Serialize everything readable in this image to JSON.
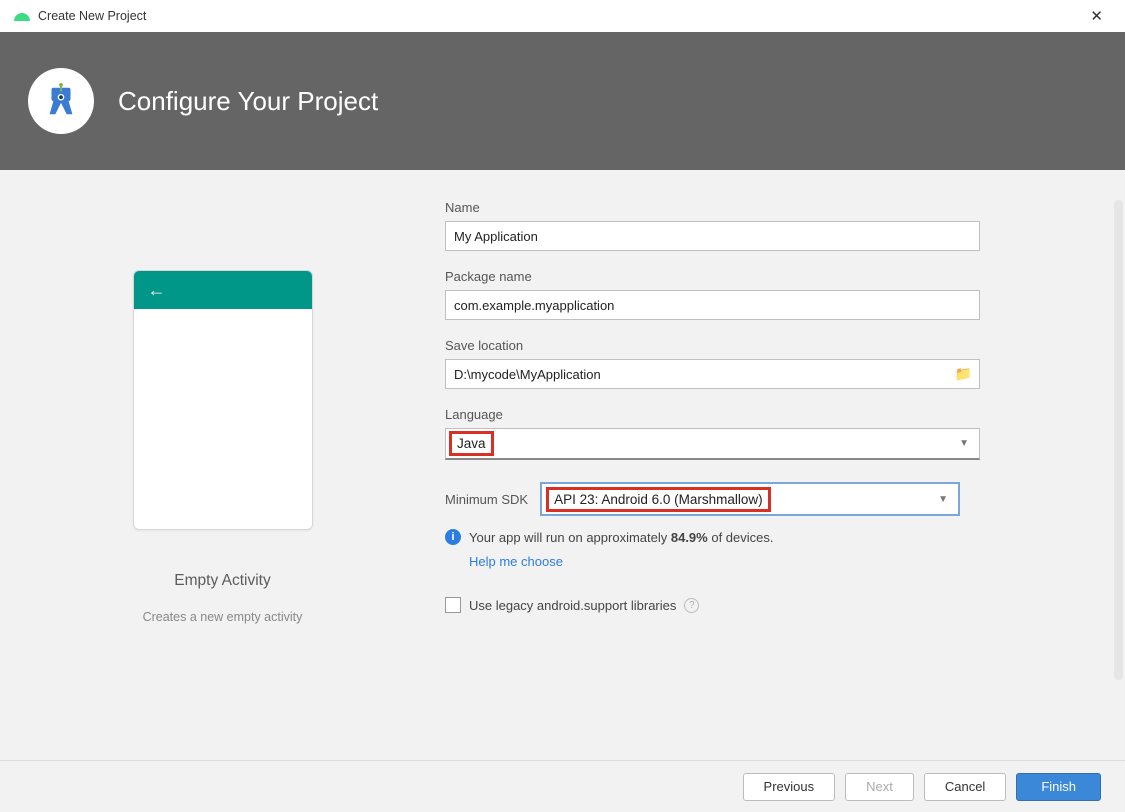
{
  "window": {
    "title": "Create New Project"
  },
  "header": {
    "title": "Configure Your Project"
  },
  "preview": {
    "title": "Empty Activity",
    "subtitle": "Creates a new empty activity"
  },
  "form": {
    "name_label": "Name",
    "name_value": "My Application",
    "package_label": "Package name",
    "package_value": "com.example.myapplication",
    "location_label": "Save location",
    "location_value": "D:\\mycode\\MyApplication",
    "language_label": "Language",
    "language_value": "Java",
    "sdk_label": "Minimum SDK",
    "sdk_value": "API 23: Android 6.0 (Marshmallow)",
    "info_pre": "Your app will run on approximately ",
    "info_pct": "84.9%",
    "info_post": " of devices.",
    "help_link": "Help me choose",
    "legacy_label": "Use legacy android.support libraries"
  },
  "footer": {
    "previous": "Previous",
    "next": "Next",
    "cancel": "Cancel",
    "finish": "Finish"
  }
}
